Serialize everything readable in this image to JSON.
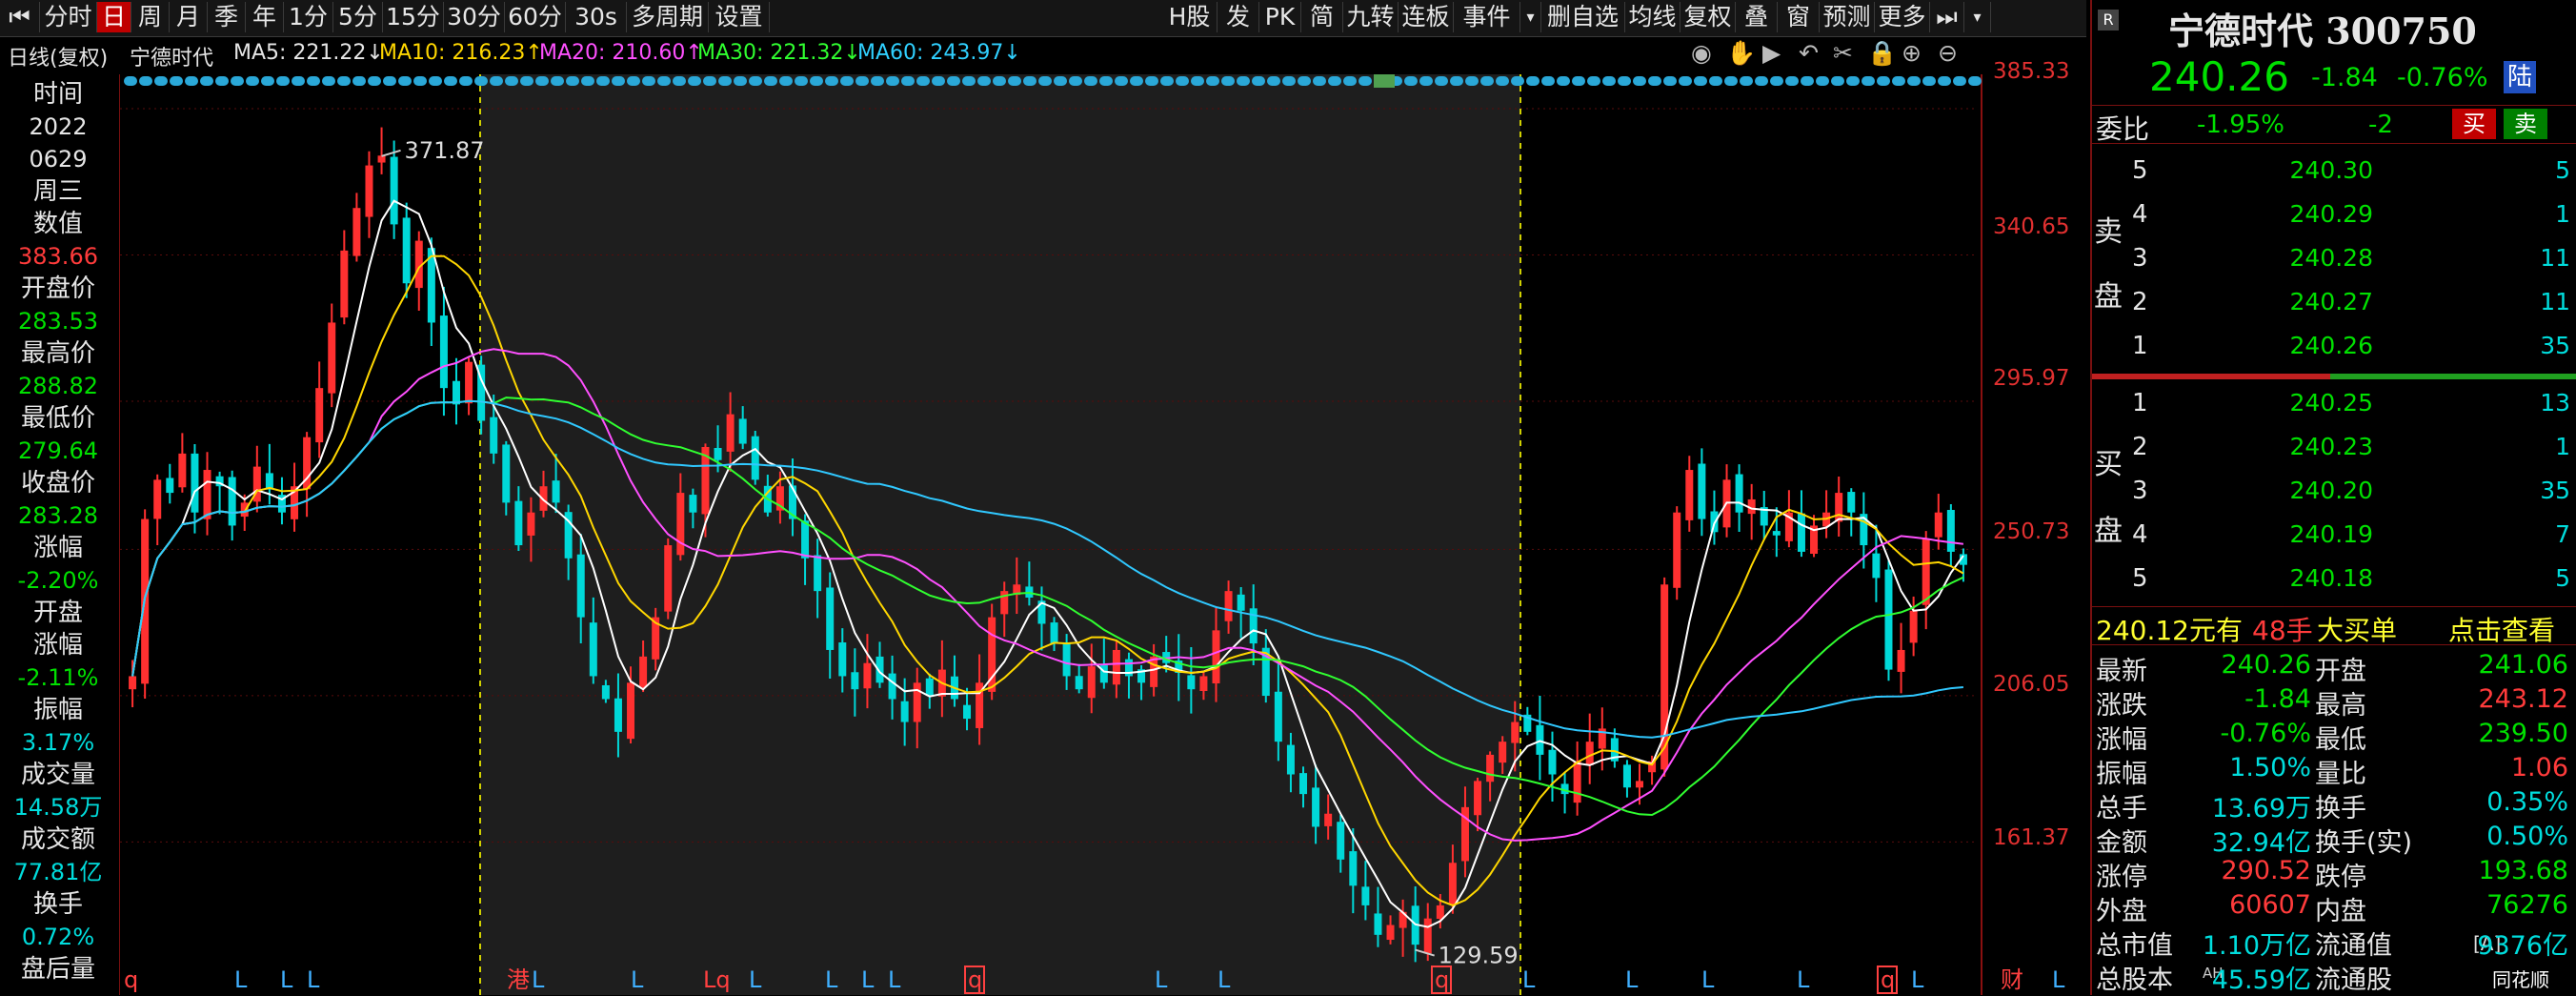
{
  "toolbar": {
    "left": [
      {
        "label": "分时",
        "active": false
      },
      {
        "label": "日",
        "active": true
      },
      {
        "label": "周",
        "active": false
      },
      {
        "label": "月",
        "active": false
      },
      {
        "label": "季",
        "active": false
      },
      {
        "label": "年",
        "active": false
      },
      {
        "label": "1分",
        "active": false
      },
      {
        "label": "5分",
        "active": false
      },
      {
        "label": "15分",
        "active": false
      },
      {
        "label": "30分",
        "active": false
      },
      {
        "label": "60分",
        "active": false
      },
      {
        "label": "30s",
        "active": false
      },
      {
        "label": "多周期",
        "active": false
      },
      {
        "label": "设置",
        "active": false
      }
    ],
    "right": [
      "H股",
      "发",
      "PK",
      "简",
      "九转",
      "连板",
      "事件",
      "删自选",
      "均线",
      "复权",
      "叠",
      "窗",
      "预测",
      "更多"
    ]
  },
  "ma_line": {
    "period": "日线(复权)",
    "stock": "宁德时代",
    "ma5": "MA5: 221.22↓",
    "ma10": "MA10: 216.23↑",
    "ma20": "MA20: 210.60↑",
    "ma30": "MA30: 221.32↓",
    "ma60": "MA60: 243.97↓"
  },
  "info_panel": {
    "time_label": "时间",
    "year": "2022",
    "date": "0629",
    "weekday": "周三",
    "value_label": "数值",
    "value": "383.66",
    "open_label": "开盘价",
    "open": "283.53",
    "high_label": "最高价",
    "high": "288.82",
    "low_label": "最低价",
    "low": "279.64",
    "close_label": "收盘价",
    "close": "283.28",
    "change_label": "涨幅",
    "change": "-2.20%",
    "open_change_label1": "开盘",
    "open_change_label2": "涨幅",
    "open_change": "-2.11%",
    "amp_label": "振幅",
    "amp": "3.17%",
    "vol_label": "成交量",
    "vol": "14.58万",
    "amount_label": "成交额",
    "amount": "77.81亿",
    "turnover_label": "换手",
    "turnover": "0.72%",
    "after_label": "盘后量"
  },
  "chart_data": {
    "type": "candlestick",
    "y_ticks": [
      "385.33",
      "340.65",
      "295.97",
      "250.73",
      "206.05",
      "161.37"
    ],
    "ylim": [
      128,
      390
    ],
    "high_annotation": "371.87",
    "low_annotation": "129.59",
    "closes": [
      212,
      260,
      272,
      268,
      280,
      262,
      275,
      270,
      258,
      265,
      276,
      269,
      262,
      270,
      285,
      300,
      320,
      342,
      355,
      368,
      371,
      350,
      332,
      345,
      320,
      300,
      295,
      308,
      290,
      280,
      265,
      252,
      262,
      270,
      265,
      248,
      230,
      212,
      205,
      195,
      210,
      218,
      230,
      252,
      268,
      262,
      282,
      278,
      292,
      283,
      272,
      262,
      270,
      260,
      248,
      238,
      220,
      212,
      208,
      216,
      210,
      205,
      198,
      210,
      206,
      214,
      205,
      199,
      210,
      230,
      238,
      240,
      236,
      228,
      222,
      212,
      208,
      215,
      210,
      220,
      212,
      210,
      218,
      216,
      213,
      208,
      212,
      226,
      238,
      232,
      222,
      206,
      192,
      182,
      176,
      166,
      170,
      156,
      148,
      142,
      133,
      136,
      140,
      130,
      138,
      142,
      155,
      172,
      180,
      188,
      192,
      198,
      195,
      188,
      182,
      176,
      186,
      192,
      196,
      186,
      178,
      180,
      186,
      240,
      262,
      275,
      260,
      256,
      272,
      262,
      266,
      258,
      255,
      262,
      250,
      258,
      262,
      268,
      262,
      252,
      242,
      214,
      220,
      232,
      254,
      262,
      250,
      246
    ],
    "x_markers": [
      "q",
      "L",
      "L",
      "L",
      "港",
      "L",
      "L",
      "Lq",
      "L",
      "L",
      "L",
      "L",
      "q",
      "L",
      "L",
      "q",
      "L",
      "L",
      "L",
      "L",
      "q",
      "L",
      "财",
      "L"
    ]
  },
  "quote": {
    "name_code": "宁德时代 300750",
    "price": "240.26",
    "change": "-1.84",
    "change_pct": "-0.76%",
    "lu_badge": "陆",
    "weibi_label": "委比",
    "weibi": "-1.95%",
    "weicha": "-2",
    "buy_btn": "买",
    "sell_btn": "卖",
    "sell_side_label1": "卖",
    "sell_side_label2": "盘",
    "buy_side_label1": "买",
    "buy_side_label2": "盘",
    "asks": [
      {
        "lvl": "5",
        "price": "240.30",
        "vol": "5"
      },
      {
        "lvl": "4",
        "price": "240.29",
        "vol": "1"
      },
      {
        "lvl": "3",
        "price": "240.28",
        "vol": "11"
      },
      {
        "lvl": "2",
        "price": "240.27",
        "vol": "11"
      },
      {
        "lvl": "1",
        "price": "240.26",
        "vol": "35"
      }
    ],
    "bids": [
      {
        "lvl": "1",
        "price": "240.25",
        "vol": "13"
      },
      {
        "lvl": "2",
        "price": "240.23",
        "vol": "1"
      },
      {
        "lvl": "3",
        "price": "240.20",
        "vol": "35"
      },
      {
        "lvl": "4",
        "price": "240.19",
        "vol": "7"
      },
      {
        "lvl": "5",
        "price": "240.18",
        "vol": "5"
      }
    ],
    "big_order": {
      "price": "240.12元有",
      "qty": "48手",
      "type": "大买单",
      "action": "点击查看"
    },
    "stats": [
      {
        "l1": "最新",
        "v1": "240.26",
        "c1": "green",
        "l2": "开盘",
        "v2": "241.06",
        "c2": "green"
      },
      {
        "l1": "涨跌",
        "v1": "-1.84",
        "c1": "green",
        "l2": "最高",
        "v2": "243.12",
        "c2": "red"
      },
      {
        "l1": "涨幅",
        "v1": "-0.76%",
        "c1": "green",
        "l2": "最低",
        "v2": "239.50",
        "c2": "green"
      },
      {
        "l1": "振幅",
        "v1": "1.50%",
        "c1": "cyan",
        "l2": "量比",
        "v2": "1.06",
        "c2": "red"
      },
      {
        "l1": "总手",
        "v1": "13.69万",
        "c1": "cyan",
        "l2": "换手",
        "v2": "0.35%",
        "c2": "cyan"
      },
      {
        "l1": "金额",
        "v1": "32.94亿",
        "c1": "cyan",
        "l2": "换手(实)",
        "v2": "0.50%",
        "c2": "cyan"
      },
      {
        "l1": "涨停",
        "v1": "290.52",
        "c1": "red",
        "l2": "跌停",
        "v2": "193.68",
        "c2": "green"
      },
      {
        "l1": "外盘",
        "v1": "60607",
        "c1": "red",
        "l2": "内盘",
        "v2": "76276",
        "c2": "green"
      },
      {
        "l1": "总市值",
        "v1": "1.10万亿",
        "c1": "cyan",
        "l2": "流通值",
        "v2": "9376亿",
        "c2": "cyan"
      },
      {
        "l1": "总股本",
        "v1": "45.59亿",
        "c1": "cyan",
        "l2": "流通股",
        "v2": "",
        "c2": "cyan"
      }
    ],
    "float_badge": "[A]",
    "ah_badge": "AH",
    "logo": "同花顺"
  }
}
